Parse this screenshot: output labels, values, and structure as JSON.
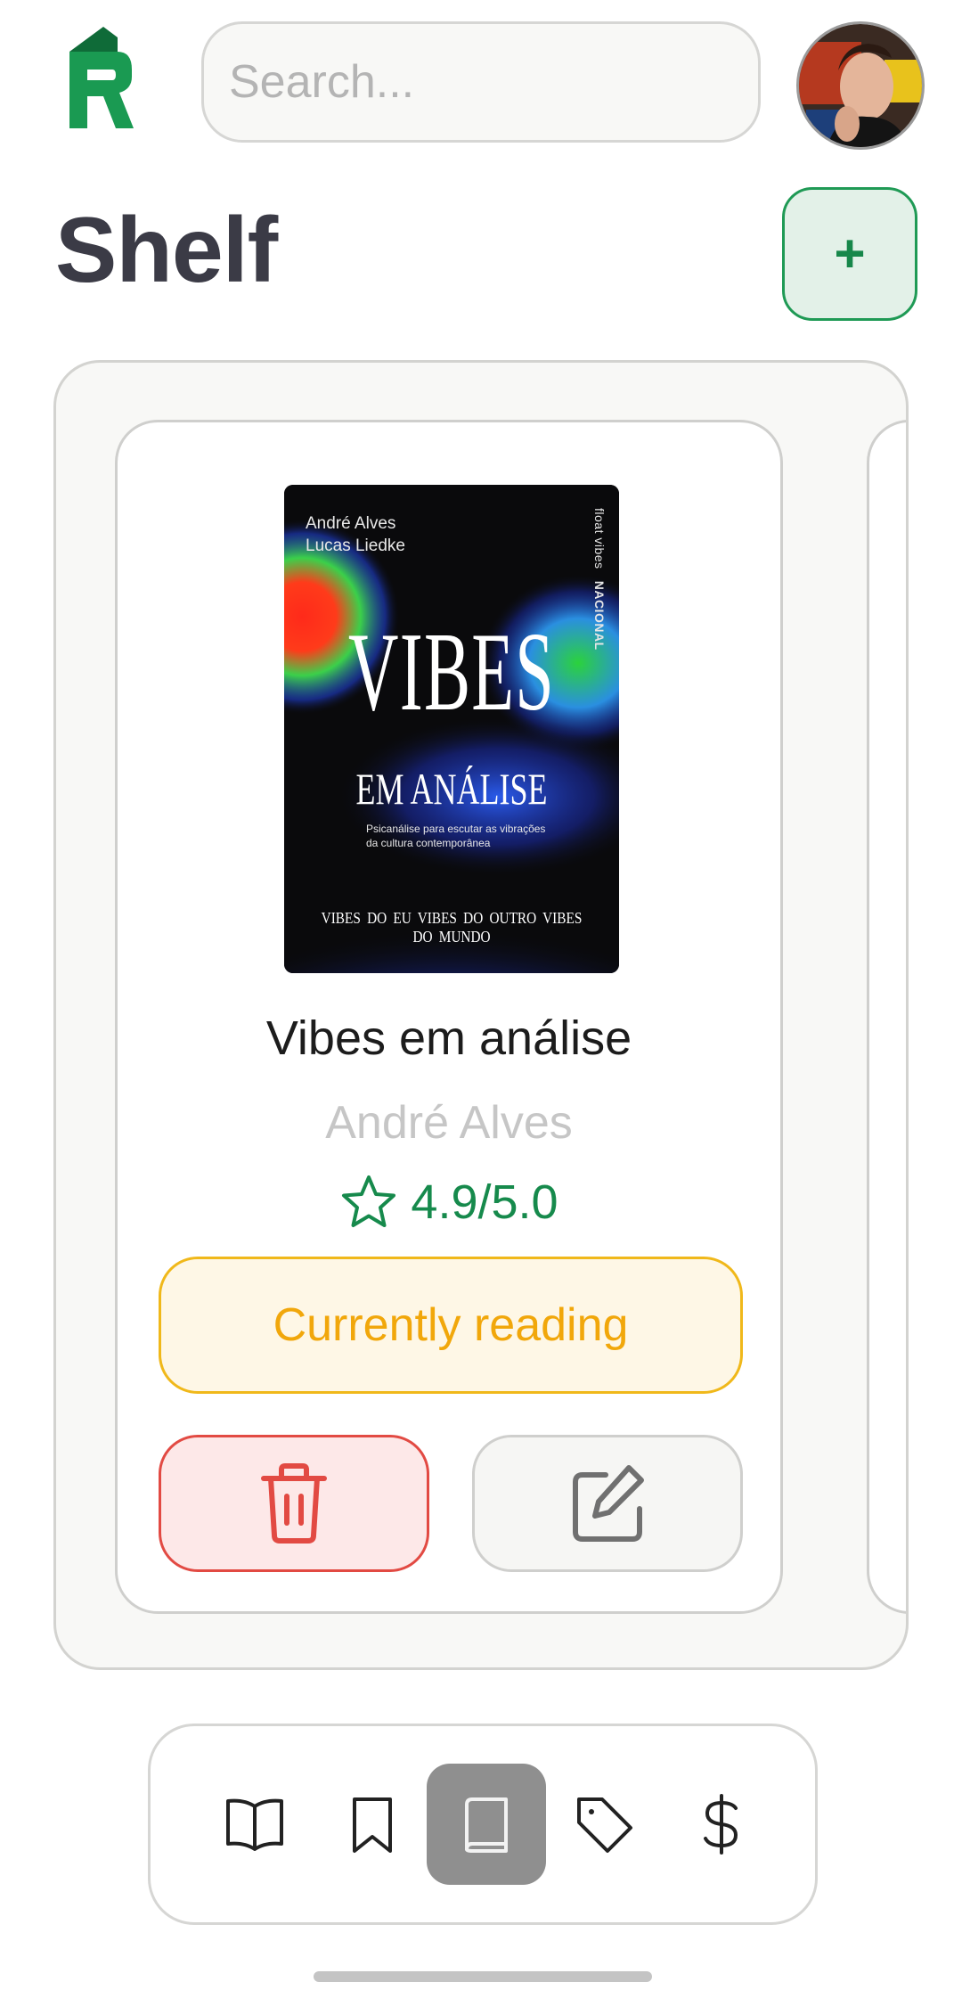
{
  "app": {
    "logo_icon": "r-house-logo",
    "brand_color": "#1a9a52"
  },
  "search": {
    "placeholder": "Search...",
    "icon": "search-icon"
  },
  "profile": {
    "avatar_icon": "user-avatar"
  },
  "page": {
    "title": "Shelf",
    "add_label": "+"
  },
  "book": {
    "title": "Vibes em análise",
    "author": "André Alves",
    "rating": "4.9/5.0",
    "status": "Currently reading",
    "cover": {
      "authors_line1": "André Alves",
      "authors_line2": "Lucas Liedke",
      "title_main": "VIBES",
      "title_sub": "EM ANÁLISE",
      "subtitle": "Psicanálise para escutar as vibrações da cultura contemporânea",
      "side_text": "float vibes",
      "side_publisher": "NACIONAL",
      "bottom_text": "VIBES DO EU   VIBES DO OUTRO   VIBES DO MUNDO"
    },
    "colors": {
      "rating": "#168a4c",
      "status": "#f1a70b",
      "delete": "#e24a43"
    }
  },
  "actions": {
    "delete_icon": "trash-icon",
    "edit_icon": "edit-icon"
  },
  "nav": {
    "items": [
      {
        "icon": "open-book-icon",
        "active": false
      },
      {
        "icon": "bookmark-icon",
        "active": false
      },
      {
        "icon": "book-icon",
        "active": true
      },
      {
        "icon": "tag-icon",
        "active": false
      },
      {
        "icon": "dollar-icon",
        "active": false
      }
    ]
  }
}
